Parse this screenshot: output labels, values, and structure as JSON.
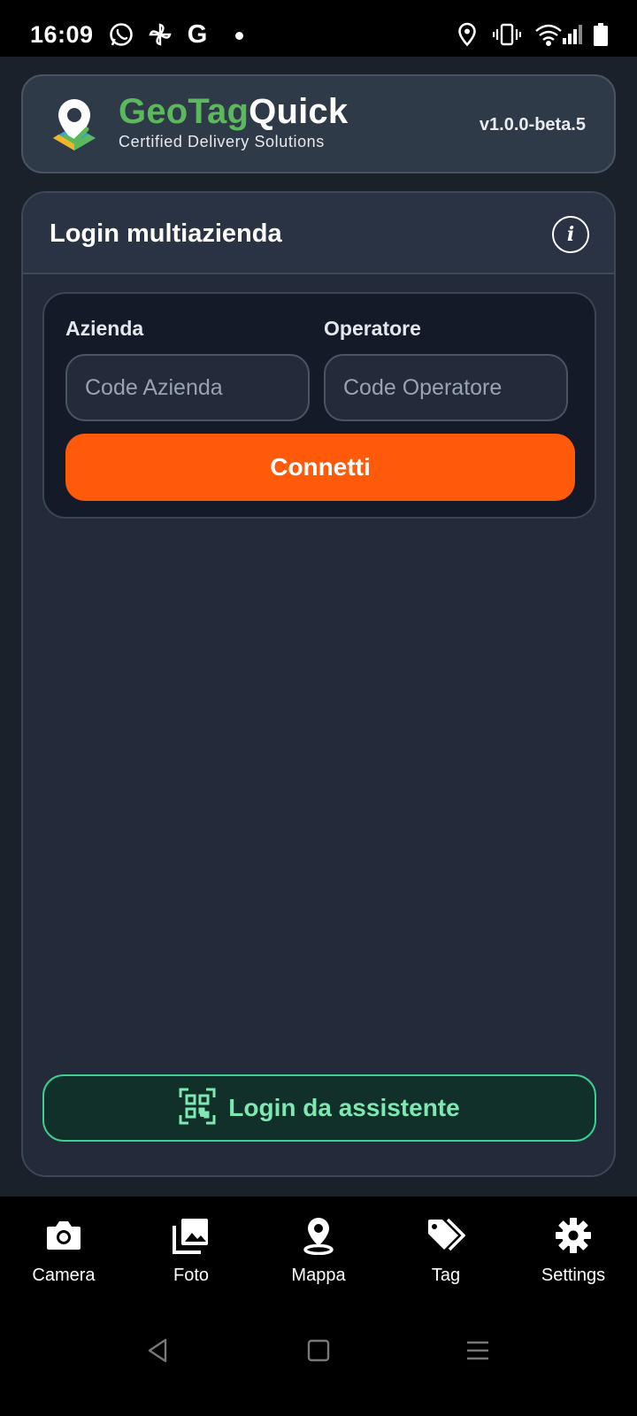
{
  "status_bar": {
    "time": "16:09",
    "left_icons": [
      "whatsapp-icon",
      "pinwheel-icon",
      "google-icon",
      "notification-dot-icon"
    ],
    "right_icons": [
      "location-icon",
      "vibrate-icon",
      "wifi-icon",
      "signal-icon",
      "battery-icon"
    ],
    "google_letter": "G"
  },
  "header": {
    "brand_part1": "GeoTag",
    "brand_part2": "Quick",
    "subtitle": "Certified Delivery Solutions",
    "version": "v1.0.0-beta.5",
    "colors": {
      "brand_green": "#5cb85c"
    }
  },
  "login": {
    "title": "Login multiazienda",
    "info_glyph": "i",
    "company_label": "Azienda",
    "company_placeholder": "Code Azienda",
    "operator_label": "Operatore",
    "operator_placeholder": "Code Operatore",
    "connect_label": "Connetti",
    "assistant_label": "Login da assistente",
    "colors": {
      "connect_bg": "#ff5a0a",
      "assistant_accent": "#3bd08f"
    }
  },
  "bottom_nav": {
    "items": [
      {
        "label": "Camera",
        "icon": "camera-icon"
      },
      {
        "label": "Foto",
        "icon": "photo-library-icon"
      },
      {
        "label": "Mappa",
        "icon": "map-pin-icon"
      },
      {
        "label": "Tag",
        "icon": "tag-icon"
      },
      {
        "label": "Settings",
        "icon": "gear-icon"
      }
    ]
  },
  "system_nav": {
    "buttons": [
      "back-icon",
      "home-icon",
      "recents-icon"
    ]
  }
}
